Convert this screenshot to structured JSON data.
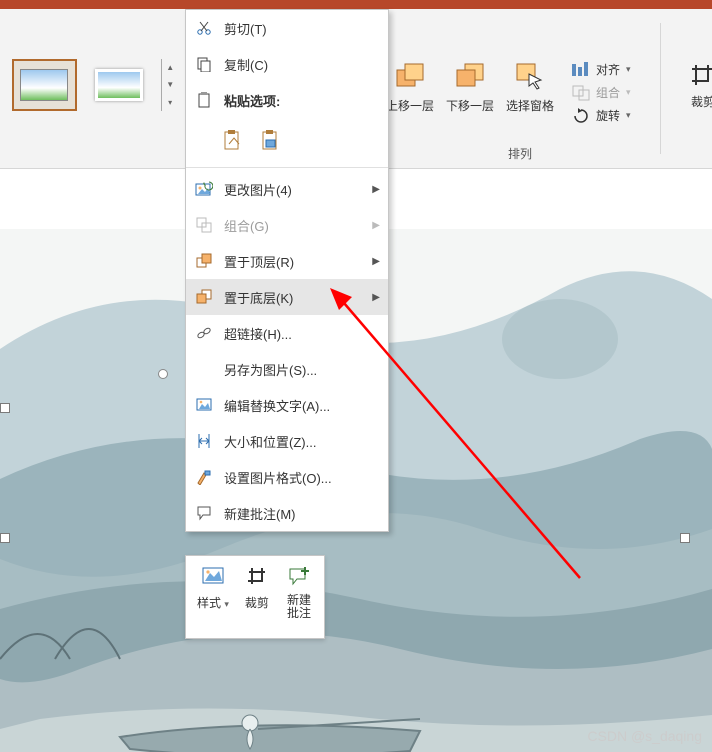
{
  "ribbon": {
    "bring_forward": "上移一层",
    "send_backward": "下移一层",
    "selection_pane": "选择窗格",
    "align": "对齐",
    "group": "组合",
    "rotate": "旋转",
    "crop": "裁剪",
    "arrange_group_label": "排列"
  },
  "menu": {
    "cut": "剪切(T)",
    "copy": "复制(C)",
    "paste_options": "粘贴选项:",
    "change_picture": "更改图片(4)",
    "group": "组合(G)",
    "bring_to_front": "置于顶层(R)",
    "send_to_back": "置于底层(K)",
    "hyperlink": "超链接(H)...",
    "save_as_picture": "另存为图片(S)...",
    "edit_alt_text": "编辑替换文字(A)...",
    "size_and_position": "大小和位置(Z)...",
    "format_picture": "设置图片格式(O)...",
    "new_comment": "新建批注(M)"
  },
  "mini": {
    "style": "样式",
    "crop": "裁剪",
    "new_comment_l1": "新建",
    "new_comment_l2": "批注"
  },
  "watermark": "CSDN @s_daqing"
}
